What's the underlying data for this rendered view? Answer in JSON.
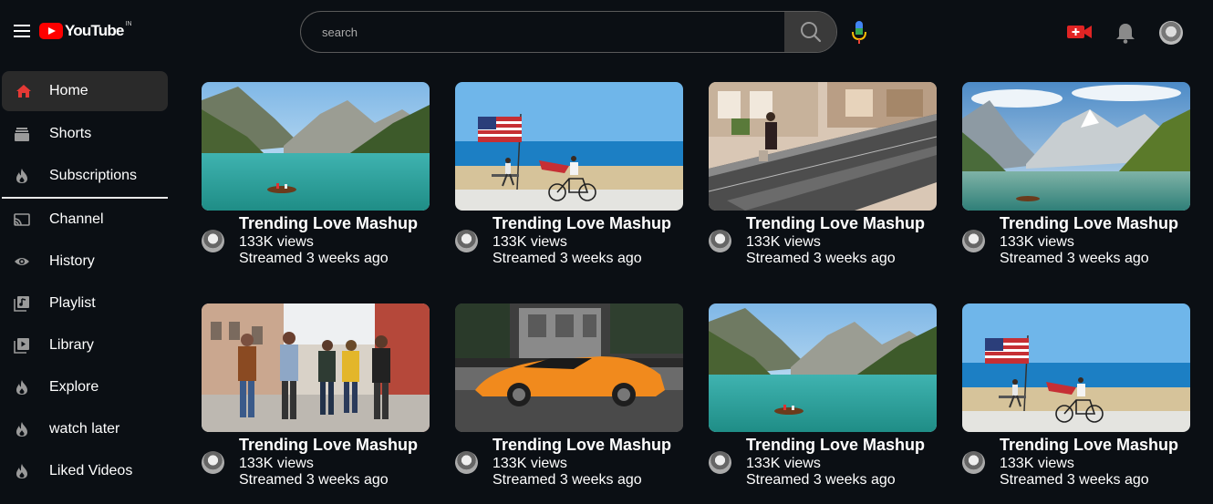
{
  "header": {
    "logo_text": "YouTube",
    "logo_country": "IN",
    "search_placeholder": "search",
    "brand_red": "#ff0000"
  },
  "sidebar": {
    "items": [
      {
        "label": "Home",
        "icon": "home-icon",
        "active": true
      },
      {
        "label": "Shorts",
        "icon": "shorts-icon"
      },
      {
        "label": "Subscriptions",
        "icon": "flame-icon"
      },
      {
        "label": "Channel",
        "icon": "cast-icon"
      },
      {
        "label": "History",
        "icon": "eye-icon"
      },
      {
        "label": "Playlist",
        "icon": "playlist-icon"
      },
      {
        "label": "Library",
        "icon": "library-icon"
      },
      {
        "label": "Explore",
        "icon": "flame-icon"
      },
      {
        "label": "watch later",
        "icon": "flame-icon"
      },
      {
        "label": "Liked Videos",
        "icon": "flame-icon"
      }
    ]
  },
  "videos": [
    {
      "title": "Trending Love Mashup",
      "views": "133K views",
      "time": "Streamed 3 weeks ago",
      "thumb": "lake-mountains"
    },
    {
      "title": "Trending Love Mashup",
      "views": "133K views",
      "time": "Streamed 3 weeks ago",
      "thumb": "beach-flag-bicycle"
    },
    {
      "title": "Trending Love Mashup",
      "views": "133K views",
      "time": "Streamed 3 weeks ago",
      "thumb": "mall-escalator"
    },
    {
      "title": "Trending Love Mashup",
      "views": "133K views",
      "time": "Streamed 3 weeks ago",
      "thumb": "alpine-lake"
    },
    {
      "title": "Trending Love Mashup",
      "views": "133K views",
      "time": "Streamed 3 weeks ago",
      "thumb": "friends-street"
    },
    {
      "title": "Trending Love Mashup",
      "views": "133K views",
      "time": "Streamed 3 weeks ago",
      "thumb": "orange-sports-car"
    },
    {
      "title": "Trending Love Mashup",
      "views": "133K views",
      "time": "Streamed 3 weeks ago",
      "thumb": "lake-mountains"
    },
    {
      "title": "Trending Love Mashup",
      "views": "133K views",
      "time": "Streamed 3 weeks ago",
      "thumb": "beach-flag-bicycle"
    }
  ]
}
